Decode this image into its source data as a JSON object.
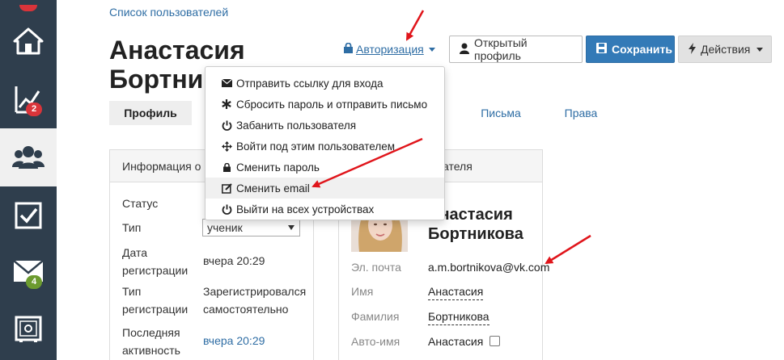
{
  "breadcrumb": "Список пользователей",
  "title": {
    "line1": "Анастасия",
    "line2": "Бортников"
  },
  "toolbar": {
    "auth_label": "Авторизация",
    "open_profile_label": "Открытый профиль",
    "save_label": "Сохранить",
    "actions_label": "Действия"
  },
  "sidebar": {
    "items": [
      {
        "icon": "home-icon"
      },
      {
        "icon": "chart-icon",
        "badge": "2"
      },
      {
        "icon": "users-icon"
      },
      {
        "icon": "checkbox-icon"
      },
      {
        "icon": "mail-icon",
        "badge": "4"
      },
      {
        "icon": "safe-icon"
      }
    ]
  },
  "tabs": [
    {
      "label": "Профиль"
    },
    {
      "label": "Письма"
    },
    {
      "label": "Права"
    }
  ],
  "dropdown": {
    "items": [
      {
        "label": "Отправить ссылку для входа",
        "icon": "envelope-icon"
      },
      {
        "label": "Сбросить пароль и отправить письмо",
        "icon": "asterisk-icon"
      },
      {
        "label": "Забанить пользователя",
        "icon": "power-icon"
      },
      {
        "label": "Войти под этим пользователем",
        "icon": "move-icon"
      },
      {
        "label": "Сменить пароль",
        "icon": "lock-icon"
      },
      {
        "label": "Сменить email",
        "icon": "edit-icon"
      },
      {
        "label": "Выйти на всех устройствах",
        "icon": "power-icon"
      }
    ]
  },
  "info_panel": {
    "header": "Информация о п",
    "status_label": "Статус",
    "type_label": "Тип",
    "type_value": "ученик",
    "reg_date_label_1": "Дата",
    "reg_date_label_2": "регистрации",
    "reg_date_value": "вчера 20:29",
    "reg_type_label_1": "Тип",
    "reg_type_label_2": "регистрации",
    "reg_type_value_1": "Зарегистрировался",
    "reg_type_value_2": "самостоятельно",
    "last_activity_label_1": "Последняя",
    "last_activity_label_2": "активность",
    "last_activity_value": "вчера 20:29"
  },
  "profile_panel": {
    "header": "ателя",
    "name_line1": "Анастасия",
    "name_line2": "Бортникова",
    "email_label": "Эл. почта",
    "email_value": "a.m.bortnikova@vk.com",
    "first_name_label": "Имя",
    "first_name_value": "Анастасия",
    "last_name_label": "Фамилия",
    "last_name_value": "Бортникова",
    "auto_name_label": "Авто-имя",
    "auto_name_value": "Анастасия"
  },
  "colors": {
    "sidebar": "#2f3e4d",
    "link": "#2e6da4",
    "primary": "#337ab7",
    "annotation": "#e0151b"
  }
}
